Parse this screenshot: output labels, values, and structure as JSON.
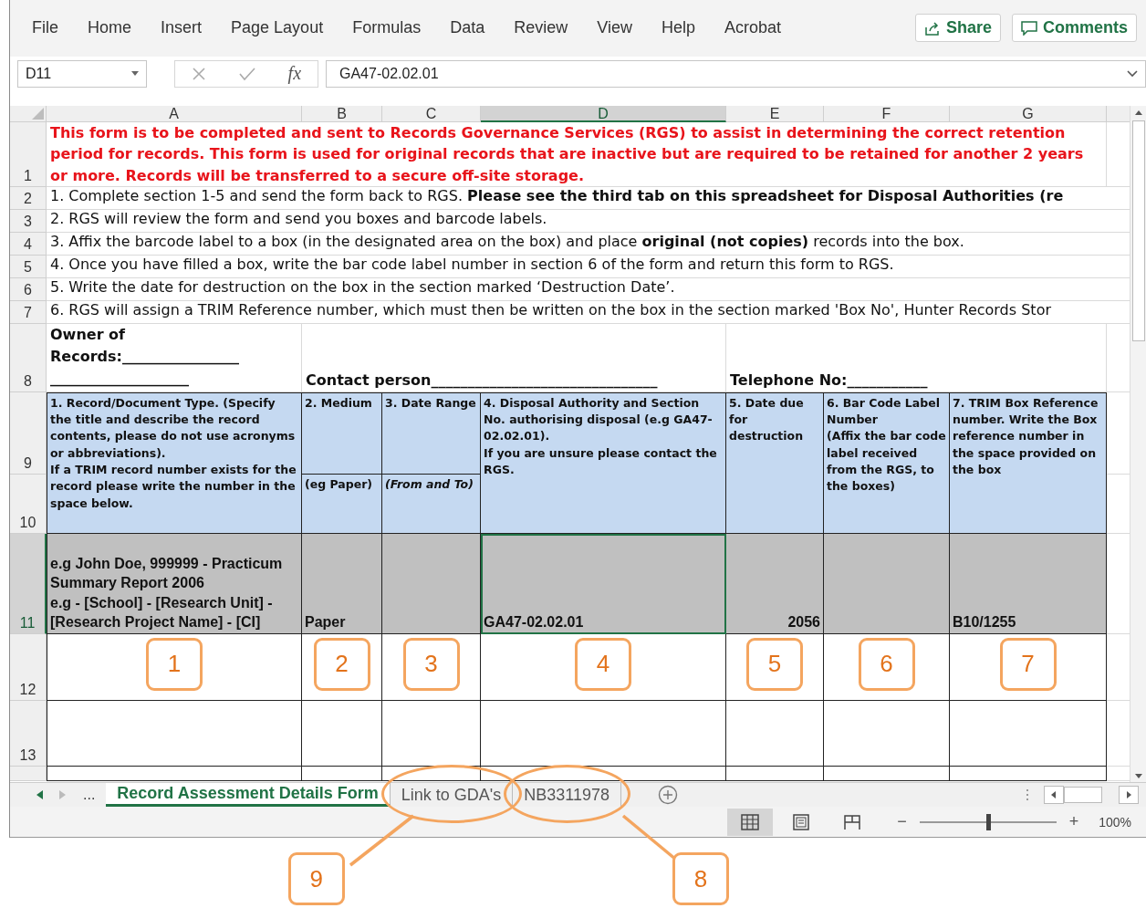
{
  "menu": [
    {
      "label": "File"
    },
    {
      "label": "Home"
    },
    {
      "label": "Insert"
    },
    {
      "label": "Page Layout"
    },
    {
      "label": "Formulas"
    },
    {
      "label": "Data"
    },
    {
      "label": "Review"
    },
    {
      "label": "View"
    },
    {
      "label": "Help"
    },
    {
      "label": "Acrobat"
    }
  ],
  "ribbon_buttons": [
    {
      "kind": "share",
      "label": "Share"
    },
    {
      "kind": "comments",
      "label": "Comments"
    }
  ],
  "formula_bar": {
    "name_box": "D11",
    "function_label": "fx",
    "formula": "GA47-02.02.01"
  },
  "sheet": {
    "columns": [
      {
        "label": "A",
        "selected": false
      },
      {
        "label": "B",
        "selected": false
      },
      {
        "label": "C",
        "selected": false
      },
      {
        "label": "D",
        "selected": true
      },
      {
        "label": "E",
        "selected": false
      },
      {
        "label": "F",
        "selected": false
      },
      {
        "label": "G",
        "selected": false
      }
    ],
    "rows": [
      {
        "label": "1",
        "selected": false
      },
      {
        "label": "2",
        "selected": false
      },
      {
        "label": "3",
        "selected": false
      },
      {
        "label": "4",
        "selected": false
      },
      {
        "label": "5",
        "selected": false
      },
      {
        "label": "6",
        "selected": false
      },
      {
        "label": "7",
        "selected": false
      },
      {
        "label": "8",
        "selected": false
      },
      {
        "label": "9",
        "selected": false
      },
      {
        "label": "10",
        "selected": false
      },
      {
        "label": "11",
        "selected": true
      },
      {
        "label": "12",
        "selected": false
      },
      {
        "label": "13",
        "selected": false
      }
    ],
    "notice": "This form is to be completed and sent to Records Governance Services (RGS) to assist in determining the correct retention period for records.  This form is used for original records that are inactive but are required to be retained for another 2 years or more.  Records will be transferred to a secure off-site storage.",
    "instructions": [
      "1. Complete section 1-5 and send the form back to RGS. **Please see the third tab on this spreadsheet for Disposal Authorities (re**",
      "2. RGS will review the form and send you boxes and barcode labels.",
      "3. Affix the barcode label to a box (in the designated area on the box) and place **original (not copies)** records into the box.",
      "4. Once you have filled a box, write the bar code label number in section 6 of the form and return this form to RGS.",
      "5. Write the date for destruction on the box in the section marked ‘Destruction Date’.",
      "6. RGS will assign a TRIM Reference number, which must then be written on the box in the section marked 'Box No', Hunter Records Stor"
    ],
    "owner_label": "Owner of\nRecords:________________\n___________________",
    "contact_label": "Contact person_______________________________",
    "telephone_label": "Telephone No:___________",
    "headers": [
      {
        "title": "1. Record/Document Type.  (Specify the  title and describe the record contents, please do not use acronyms or abbreviations).\nIf a TRIM record number exists for the record please write the number in the space below."
      },
      {
        "title": "2. Medium",
        "subtitle": "(eg Paper)",
        "subtitle_italic": false
      },
      {
        "title": "3. Date Range",
        "subtitle": "(From and To)",
        "subtitle_italic": true
      },
      {
        "title": "4. Disposal Authority and Section No. authorising disposal (e.g GA47-02.02.01).\nIf you are unsure please contact the RGS."
      },
      {
        "title": "5. Date due for destruction"
      },
      {
        "title": "6. Bar Code Label Number\n(Affix the bar code label received from the RGS, to the boxes)"
      },
      {
        "title": "7. TRIM Box Reference number.  Write the Box reference number in the space provided on the box"
      }
    ],
    "example_row": [
      {
        "kind": "text",
        "text": "e.g John Doe, 999999 - Practicum Summary Report 2006\ne.g - [School] - [Research Unit] - [Research Project Name] - [CI]",
        "selected": false
      },
      {
        "kind": "text",
        "text": "Paper",
        "selected": false
      },
      {
        "kind": "empty",
        "selected": false
      },
      {
        "kind": "text",
        "text": "GA47-02.02.01",
        "selected": true
      },
      {
        "kind": "number",
        "text": "2056",
        "selected": false
      },
      {
        "kind": "empty",
        "selected": false
      },
      {
        "kind": "text",
        "text": "B10/1255",
        "selected": false
      }
    ],
    "callouts": [
      "1",
      "2",
      "3",
      "4",
      "5",
      "6",
      "7"
    ]
  },
  "sheet_tabs": [
    {
      "label": "Record Assessment Details Form",
      "selected": true
    },
    {
      "label": "Link to GDA's",
      "selected": false,
      "callout": "9"
    },
    {
      "label": "NB3311978",
      "selected": false,
      "callout": "8"
    }
  ],
  "tab_overflow": "...",
  "status_bar": {
    "views": [
      {
        "kind": "normal",
        "selected": true
      },
      {
        "kind": "page_layout",
        "selected": false
      },
      {
        "kind": "page_break",
        "selected": false
      }
    ],
    "zoom_out": "−",
    "zoom_in": "+",
    "zoom": {
      "level": 0.5,
      "reading": "100%"
    }
  }
}
